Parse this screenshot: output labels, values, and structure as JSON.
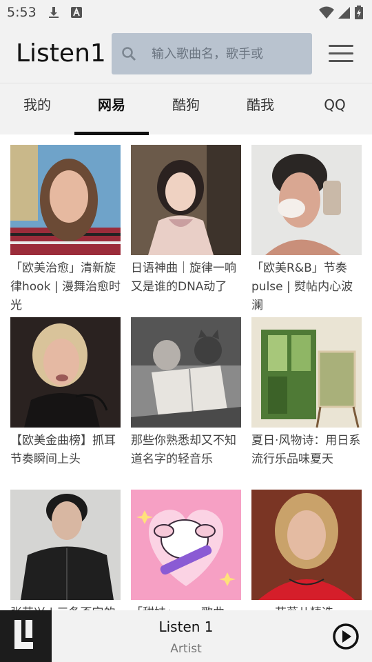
{
  "status_bar": {
    "time": "5:53",
    "icons": [
      "download-icon",
      "keyboard-a-icon",
      "wifi-icon",
      "signal-icon",
      "battery-icon"
    ]
  },
  "header": {
    "app_title": "Listen1",
    "search_placeholder": "输入歌曲名，歌手或",
    "search_value": ""
  },
  "tabs": [
    {
      "label": "我的",
      "active": false
    },
    {
      "label": "网易",
      "active": true
    },
    {
      "label": "酷狗",
      "active": false
    },
    {
      "label": "酷我",
      "active": false
    },
    {
      "label": "QQ",
      "active": false
    }
  ],
  "playlists": [
    {
      "title": "「欧美治愈」清新旋律hook | 漫舞治愈时光"
    },
    {
      "title": "日语神曲｜旋律一响又是谁的DNA动了"
    },
    {
      "title": "「欧美R&B」节奏pulse | 熨帖内心波澜"
    },
    {
      "title": "【欧美金曲榜】抓耳节奏瞬间上头"
    },
    {
      "title": "那些你熟悉却又不知道名字的轻音乐"
    },
    {
      "title": "夏日·风物诗：用日系流行乐品味夏天"
    },
    {
      "title": "张艺兴 | 三条否定的"
    },
    {
      "title": "「甜妹」……歌曲"
    },
    {
      "title": "……艾薇儿精选"
    }
  ],
  "player": {
    "song_title": "Listen 1",
    "artist": "Artist"
  },
  "colors": {
    "chrome_bg": "#f2f2f2",
    "search_bg": "#b9c3cf",
    "active_tab_indicator": "#111111",
    "logo_bg": "#1c1c1c"
  }
}
